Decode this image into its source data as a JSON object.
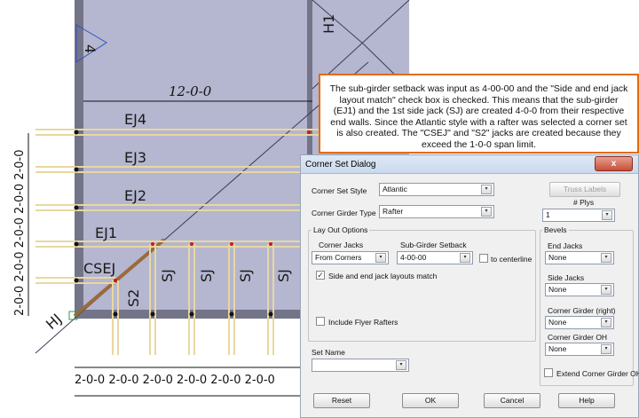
{
  "drawing": {
    "member_labels": [
      "H1",
      "EJ4",
      "EJ3",
      "EJ2",
      "EJ1",
      "CSEJ",
      "S2",
      "SJ",
      "SJ",
      "SJ",
      "SJ",
      "HJ"
    ],
    "dimension_top": "12-0-0",
    "dimension_left": "2-0-0 2-0-0 2-0-0 2-0-0 2-0-0",
    "dimension_bottom": "2-0-0 2-0-0 2-0-0 2-0-0 2-0-0 2-0-0",
    "marker": "4"
  },
  "callout": {
    "text": "The sub-girder setback was input as 4-00-00 and the \"Side and end jack layout match\" check box is checked. This means that the sub-girder (EJ1) and the 1st side jack (SJ) are created 4-0-0 from their respective end walls. Since the Atlantic style with a rafter was selected a corner set is also created. The \"CSEJ\" and \"S2\" jacks are created because they exceed the 1-0-0 span limit."
  },
  "dialog": {
    "title": "Corner Set Dialog",
    "close": "x",
    "corner_set_style_label": "Corner Set Style",
    "corner_set_style_value": "Atlantic",
    "corner_girder_type_label": "Corner Girder Type",
    "corner_girder_type_value": "Rafter",
    "truss_labels_button": "Truss Labels",
    "plys_label": "# Plys",
    "plys_value": "1",
    "layout_group": "Lay Out Options",
    "corner_jacks_label": "Corner Jacks",
    "corner_jacks_value": "From Corners",
    "sub_girder_setback_label": "Sub-Girder Setback",
    "sub_girder_setback_value": "4-00-00",
    "to_centerline_label": "to centerline",
    "side_end_match_label": "Side and end jack layouts match",
    "include_flyer_label": "Include Flyer Rafters",
    "set_name_label": "Set Name",
    "set_name_value": "",
    "bevels_group": "Bevels",
    "end_jacks_label": "End Jacks",
    "end_jacks_value": "None",
    "side_jacks_label": "Side Jacks",
    "side_jacks_value": "None",
    "corner_girder_right_label": "Corner Girder (right)",
    "corner_girder_right_value": "None",
    "corner_girder_oh_label": "Corner Girder OH",
    "corner_girder_oh_value": "None",
    "extend_corner_girder_oh_label": "Extend Corner Girder OH",
    "reset_button": "Reset",
    "ok_button": "OK",
    "cancel_button": "Cancel",
    "help_button": "Help",
    "check_glyph": "✓",
    "arrow_glyph": "▾"
  },
  "colors": {
    "roof_fill": "#b5b6cf",
    "wall": "#737488",
    "callout_border": "#e36c09",
    "red_dot": "#cc1a1a",
    "member": "#e8d8a0"
  }
}
